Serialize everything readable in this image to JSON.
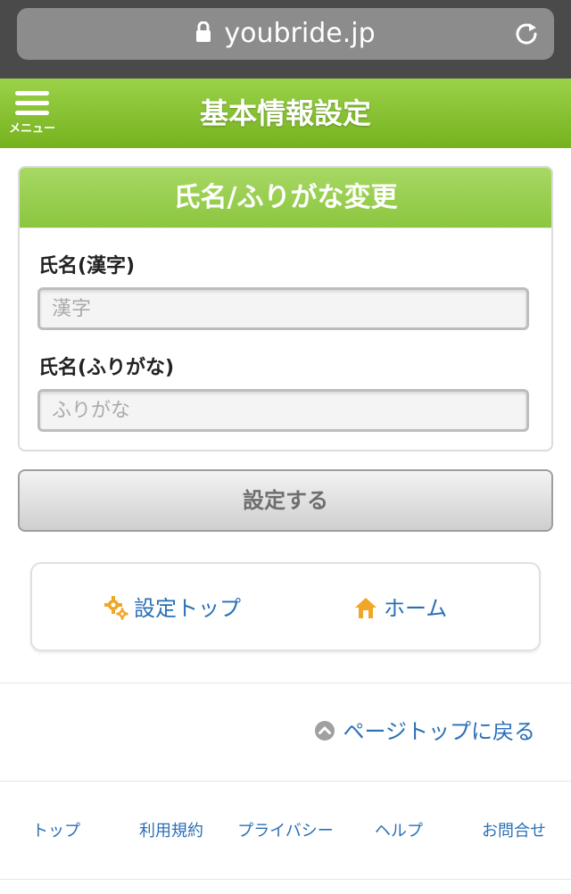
{
  "browser": {
    "url": "youbride.jp",
    "lock_icon": "lock-icon",
    "reload_icon": "reload-icon"
  },
  "header": {
    "menu_label": "メニュー",
    "title": "基本情報設定",
    "color_top": "#9bd24a",
    "color_bottom": "#76b21e"
  },
  "form": {
    "title": "氏名/ふりがな変更",
    "kanji_label": "氏名(漢字)",
    "kanji_placeholder": "漢字",
    "kanji_value": "",
    "furigana_label": "氏名(ふりがな)",
    "furigana_placeholder": "ふりがな",
    "furigana_value": "",
    "submit_label": "設定する"
  },
  "nav": {
    "settings_top": "設定トップ",
    "home": "ホーム",
    "settings_icon": "gear-icon",
    "home_icon": "house-icon"
  },
  "page_top": {
    "label": "ページトップに戻る",
    "icon": "chevron-up-circle-icon"
  },
  "footer": {
    "links": [
      "トップ",
      "利用規約",
      "プライバシー",
      "ヘルプ",
      "お問合せ"
    ]
  }
}
